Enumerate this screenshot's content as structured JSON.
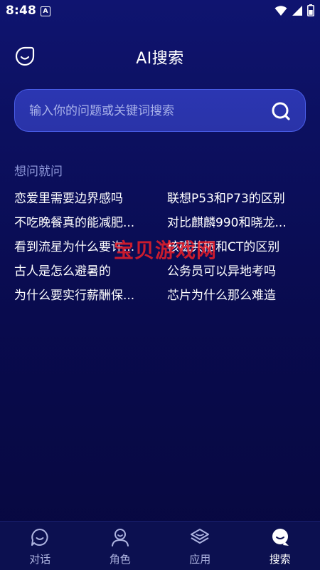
{
  "status": {
    "time": "8:48",
    "notification_icon": "A"
  },
  "header": {
    "title": "AI搜索",
    "left_icon": "smile-icon"
  },
  "search": {
    "placeholder": "输入你的问题或关键词搜索",
    "value": "",
    "icon": "search-icon"
  },
  "suggestions": {
    "title": "想问就问",
    "items": [
      "恋爱里需要边界感吗",
      "联想P53和P73的区别",
      "不吃晚餐真的能减肥...",
      "对比麒麟990和晓龙...",
      "看到流星为什么要许...",
      "核磁共振和CT的区别",
      "古人是怎么避暑的",
      "公务员可以异地考吗",
      "为什么要实行薪酬保...",
      "芯片为什么那么难造"
    ]
  },
  "tabs": [
    {
      "label": "对话",
      "icon": "chat-icon",
      "active": false
    },
    {
      "label": "角色",
      "icon": "person-icon",
      "active": false
    },
    {
      "label": "应用",
      "icon": "layers-icon",
      "active": false
    },
    {
      "label": "搜索",
      "icon": "search-tab-icon",
      "active": true
    }
  ],
  "watermark": {
    "text": "宝贝游戏网"
  },
  "colors": {
    "accent": "#4a5ee8",
    "background_top": "#0f1470",
    "background_bottom": "#07083f"
  }
}
